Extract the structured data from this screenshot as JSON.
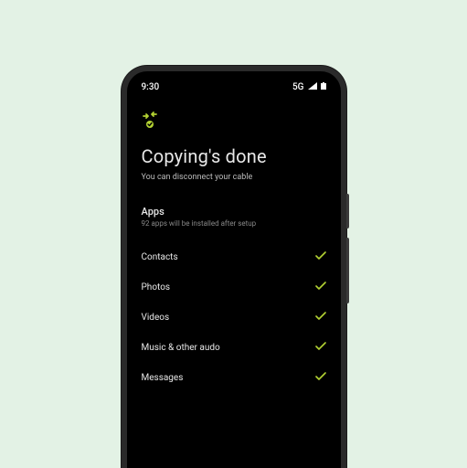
{
  "statusBar": {
    "time": "9:30",
    "network": "5G"
  },
  "page": {
    "title": "Copying's done",
    "subtitle": "You can disconnect your cable"
  },
  "appsSection": {
    "title": "Apps",
    "subtitle": "92 apps will be installed after setup"
  },
  "items": [
    {
      "label": "Contacts"
    },
    {
      "label": "Photos"
    },
    {
      "label": "Videos"
    },
    {
      "label": "Music & other audo"
    },
    {
      "label": "Messages"
    }
  ],
  "colors": {
    "accent": "#b3d233",
    "background": "#e3f2e5"
  }
}
